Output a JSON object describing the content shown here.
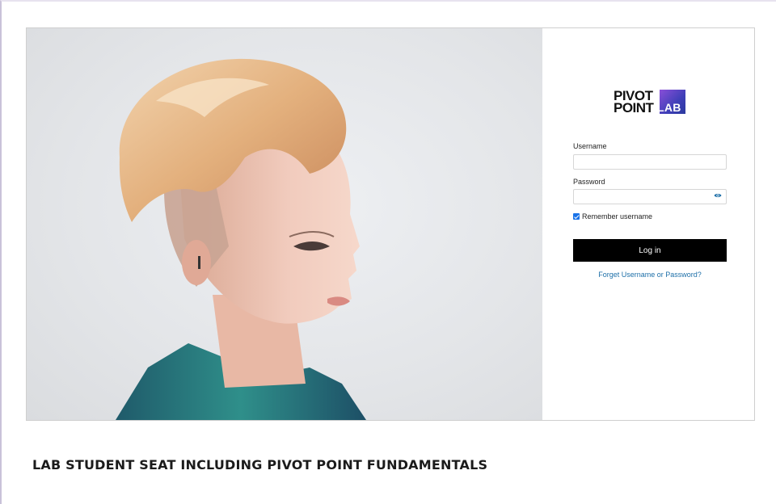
{
  "login": {
    "logo_line1": "PIVOT",
    "logo_line2": "POINT",
    "logo_badge": "LAB",
    "username_label": "Username",
    "username_value": "",
    "password_label": "Password",
    "password_value": "",
    "remember_label": "Remember username",
    "remember_checked": true,
    "login_button": "Log in",
    "forgot_link": "Forget Username or Password?"
  },
  "caption": "LAB STUDENT SEAT INCLUDING PIVOT POINT FUNDAMENTALS",
  "colors": {
    "button_bg": "#000000",
    "link": "#1d6fa8",
    "checkbox": "#1a73e8",
    "logo_gradient_start": "#8a4fd8",
    "logo_gradient_end": "#2b3a9e"
  },
  "icons": {
    "password_toggle": "eye-icon",
    "remember": "checkbox-checked-icon"
  }
}
